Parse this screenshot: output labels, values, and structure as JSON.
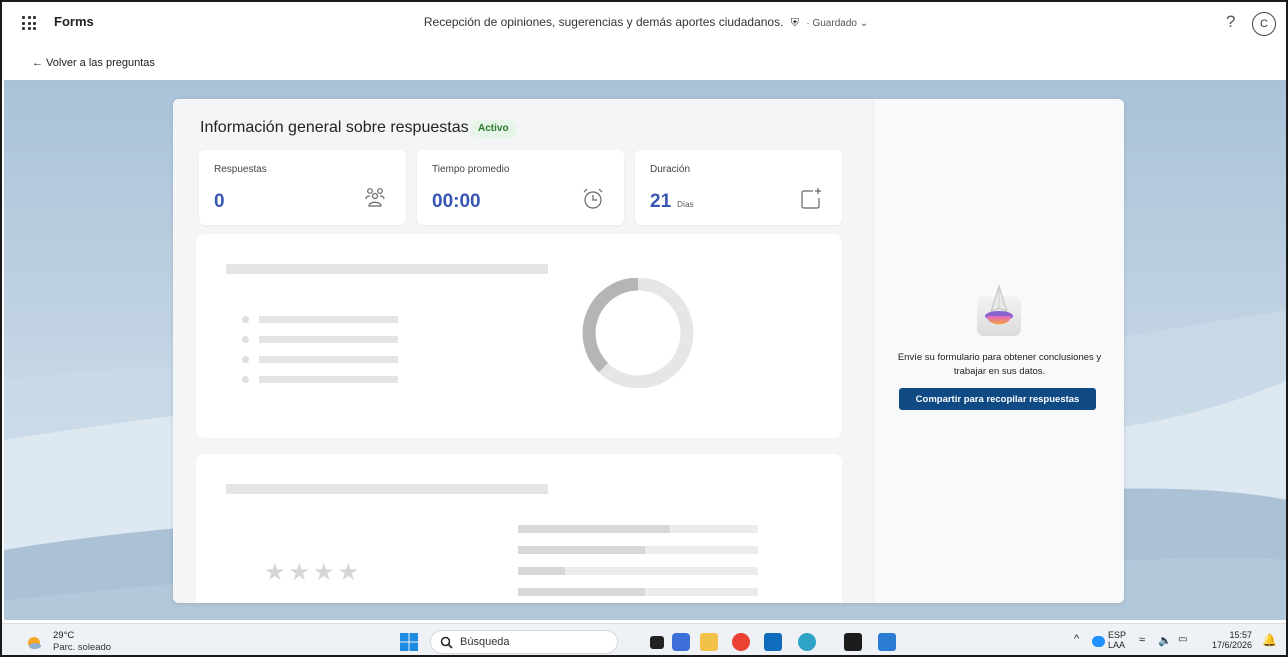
{
  "app": {
    "name": "Forms"
  },
  "document": {
    "title": "Recepción de opiniones, sugerencias y demás aportes ciudadanos.",
    "save_status": "Guardado"
  },
  "header": {
    "help_label": "?",
    "user_initial": "C"
  },
  "back_link": "← Volver a las preguntas",
  "overview": {
    "title": "Información general sobre respuestas",
    "status_badge": "Activo",
    "stats": [
      {
        "label": "Respuestas",
        "value": "0",
        "icon": "people-icon"
      },
      {
        "label": "Tiempo promedio",
        "value": "00:00",
        "icon": "alarm-clock-icon"
      },
      {
        "label": "Duración",
        "value": "21",
        "unit": "Días",
        "icon": "calendar-add-icon"
      }
    ]
  },
  "share_panel": {
    "message": "Envíe su formulario para obtener conclusiones y trabajar en sus datos.",
    "button_label": "Compartir para recopilar respuestas"
  },
  "taskbar": {
    "weather_temp": "29°C",
    "weather_desc": "Parc. soleado",
    "search_placeholder": "Búsqueda",
    "language": "ESP",
    "keyboard_layout": "LAA",
    "time": "15:57",
    "date": "17/6/2026"
  },
  "colors": {
    "accent": "#3855b3",
    "button": "#0f4a85",
    "badge_text": "#2a7a2e"
  }
}
